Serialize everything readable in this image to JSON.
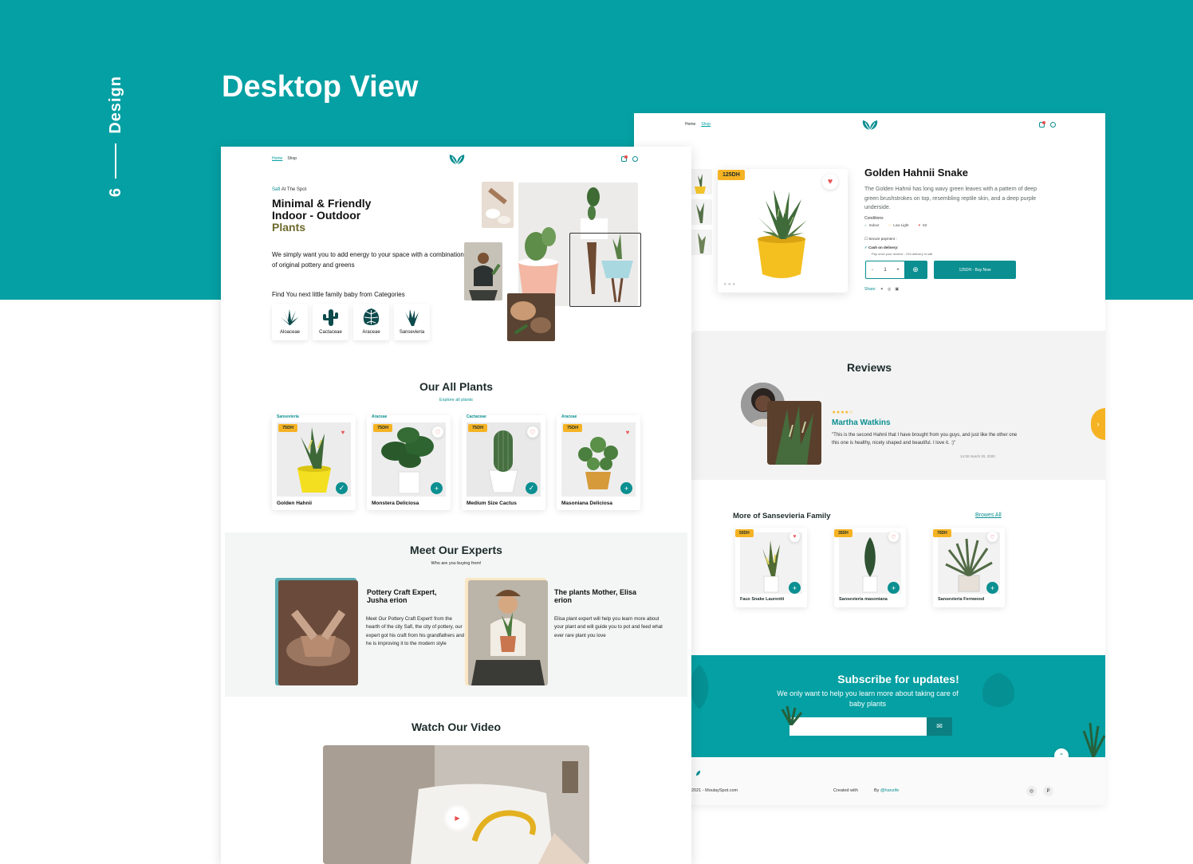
{
  "page": {
    "title": "Desktop View",
    "section_number": "6",
    "section_label": "Design"
  },
  "colors": {
    "brand": "#05a0a3",
    "accent": "#f5b324",
    "heart": "#e85b5b"
  },
  "detail": {
    "nav": [
      "Home",
      "Shop"
    ],
    "product": {
      "price": "125DH",
      "name": "Golden Hahnii Snake",
      "description": "The Golden Hahnii  has long wavy green leaves with a pattern of deep green brushstrokes on top, resembling reptile skin, and a deep purple underside.",
      "conditions_label": "Conditions",
      "conditions": [
        "Indoor",
        "Low Light",
        "53"
      ],
      "secure_payment": "Secure payment :",
      "cash_on_delivery": "Cash on delivery:",
      "cash_note": "Pay once your recieve - 24h delivery in safi",
      "qty_minus": "-",
      "qty_value": "1",
      "qty_plus": "+",
      "buy_label": "125DH - Buy Now",
      "share_label": "Share:"
    },
    "reviews": {
      "title": "Reviews",
      "stars": "★★★★☆",
      "name": "Martha Watkins",
      "text": "\"This is the second Hahnii that I have brought from you guys, and just like the other one this one is healthy, nicely shaped and beautiful. I love it. :)\"",
      "date": "14:30 march 20, 2020"
    },
    "more": {
      "title": "More of Sansevieria Family",
      "browse": "Browes All",
      "items": [
        {
          "price": "50DH",
          "name": "Faux Snake Laurentii"
        },
        {
          "price": "35DH",
          "name": "Sansevieria masoniana"
        },
        {
          "price": "70DH",
          "name": "Sansevieria Fernwood"
        }
      ]
    },
    "subscribe": {
      "title": "Subscribe for updates!",
      "text": "We only want to help you learn more about taking care of baby plants",
      "placeholder": ""
    },
    "footer": {
      "copyright": "2021 - MoulaySpot.com",
      "created": "Created with",
      "by": "By",
      "handle": "@hanzife"
    }
  },
  "home": {
    "nav": [
      "Home",
      "Shop"
    ],
    "hero": {
      "kicker_accent": "Safi",
      "kicker": "At The Spot",
      "title_line1": "Minimal & Friendly",
      "title_line2": "Indoor - Outdoor",
      "title_line3": "Plants",
      "desc": "We simply want you to add energy to your space with a combination of original pottery and greens",
      "cat_title": "Find You next little family baby from Categories"
    },
    "categories": [
      "Aloaceae",
      "Cactaceae",
      "Araceae",
      "Sansevieria"
    ],
    "plants": {
      "title": "Our All Plants",
      "subtitle": "Explore all plants",
      "items": [
        {
          "category": "Sansevieria",
          "price": "75DH",
          "name": "Golden Hahnii"
        },
        {
          "category": "Araceae",
          "price": "75DH",
          "name": "Monstera Deliciosa"
        },
        {
          "category": "Cactaceae",
          "price": "75DH",
          "name": "Medium Size Cactus"
        },
        {
          "category": "Araceae",
          "price": "75DH",
          "name": "Masoniana Deliciosa"
        }
      ]
    },
    "experts": {
      "title": "Meet Our Experts",
      "subtitle": "Who are you buying from!",
      "items": [
        {
          "name": "Pottery Craft Expert, Jusha erion",
          "text": "Meet Our Pottery Craft Expert! from the hearth of the city Safi, the city of pottery, our expert got his craft from his grandfathers and he is improving it to the modern style"
        },
        {
          "name": "The plants Mother, Elisa erion",
          "text": "Elisa plant expert will help you learn more about your plant and will guide you to pot and feed what ever rare plant you love"
        }
      ]
    },
    "video": {
      "title": "Watch Our Video"
    }
  }
}
